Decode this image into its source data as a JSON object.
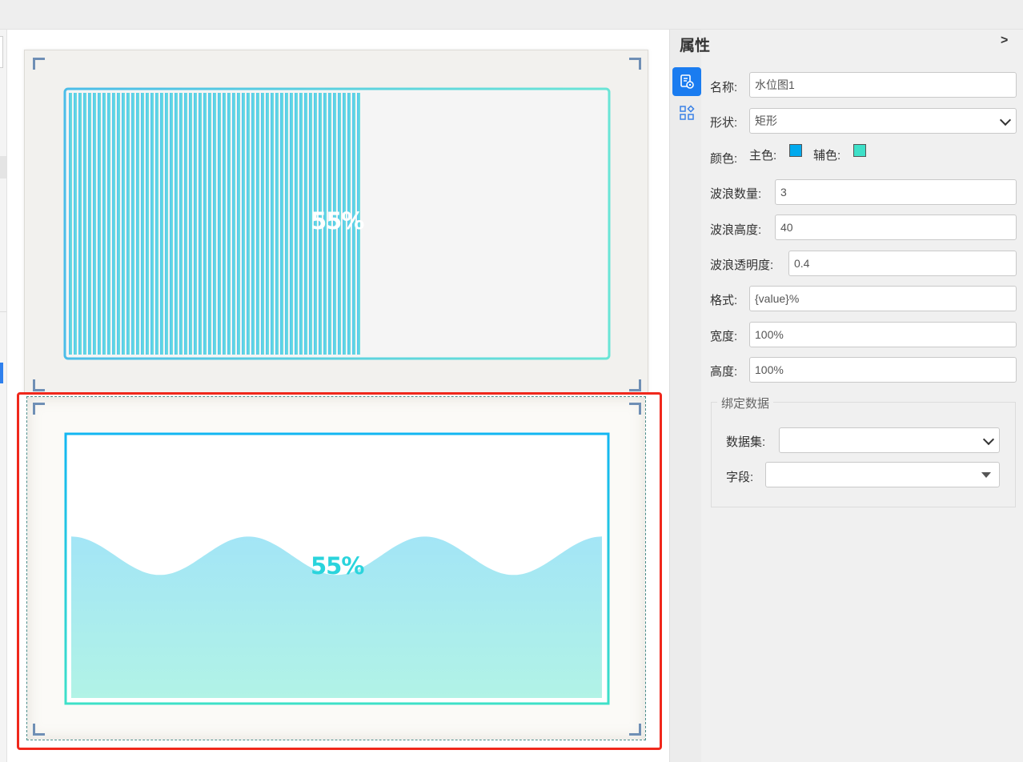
{
  "canvas": {
    "widget1": {
      "shape": "rectangle-bars",
      "percent_text": "55%",
      "level": 0.55
    },
    "widget2": {
      "shape": "rectangle-wave",
      "percent_text": "55%",
      "level": 0.55
    }
  },
  "panel": {
    "title": "属性",
    "collapse_label": ">",
    "tabs": [
      {
        "icon": "style-settings-icon",
        "active": true
      },
      {
        "icon": "components-grid-icon",
        "active": false
      }
    ],
    "fields": {
      "name": {
        "label": "名称:",
        "value": "水位图1"
      },
      "shape": {
        "label": "形状:",
        "value": "矩形"
      },
      "color": {
        "label": "颜色:",
        "primary_label": "主色:",
        "secondary_label": "辅色:",
        "primary": "#00aaee",
        "secondary": "#3ee0c8"
      },
      "wave_count": {
        "label": "波浪数量:",
        "value": "3"
      },
      "wave_height": {
        "label": "波浪高度:",
        "value": "40"
      },
      "wave_opacity": {
        "label": "波浪透明度:",
        "value": "0.4"
      },
      "format": {
        "label": "格式:",
        "value": "{value}%"
      },
      "width": {
        "label": "宽度:",
        "value": "100%"
      },
      "height": {
        "label": "高度:",
        "value": "100%"
      }
    },
    "binding": {
      "legend": "绑定数据",
      "dataset": {
        "label": "数据集:",
        "value": ""
      },
      "field": {
        "label": "字段:",
        "value": ""
      }
    }
  },
  "colors": {
    "primary": "#00aaee",
    "secondary": "#3ee0c8",
    "selection": "#f0281c",
    "accent": "#1a7cf0"
  }
}
